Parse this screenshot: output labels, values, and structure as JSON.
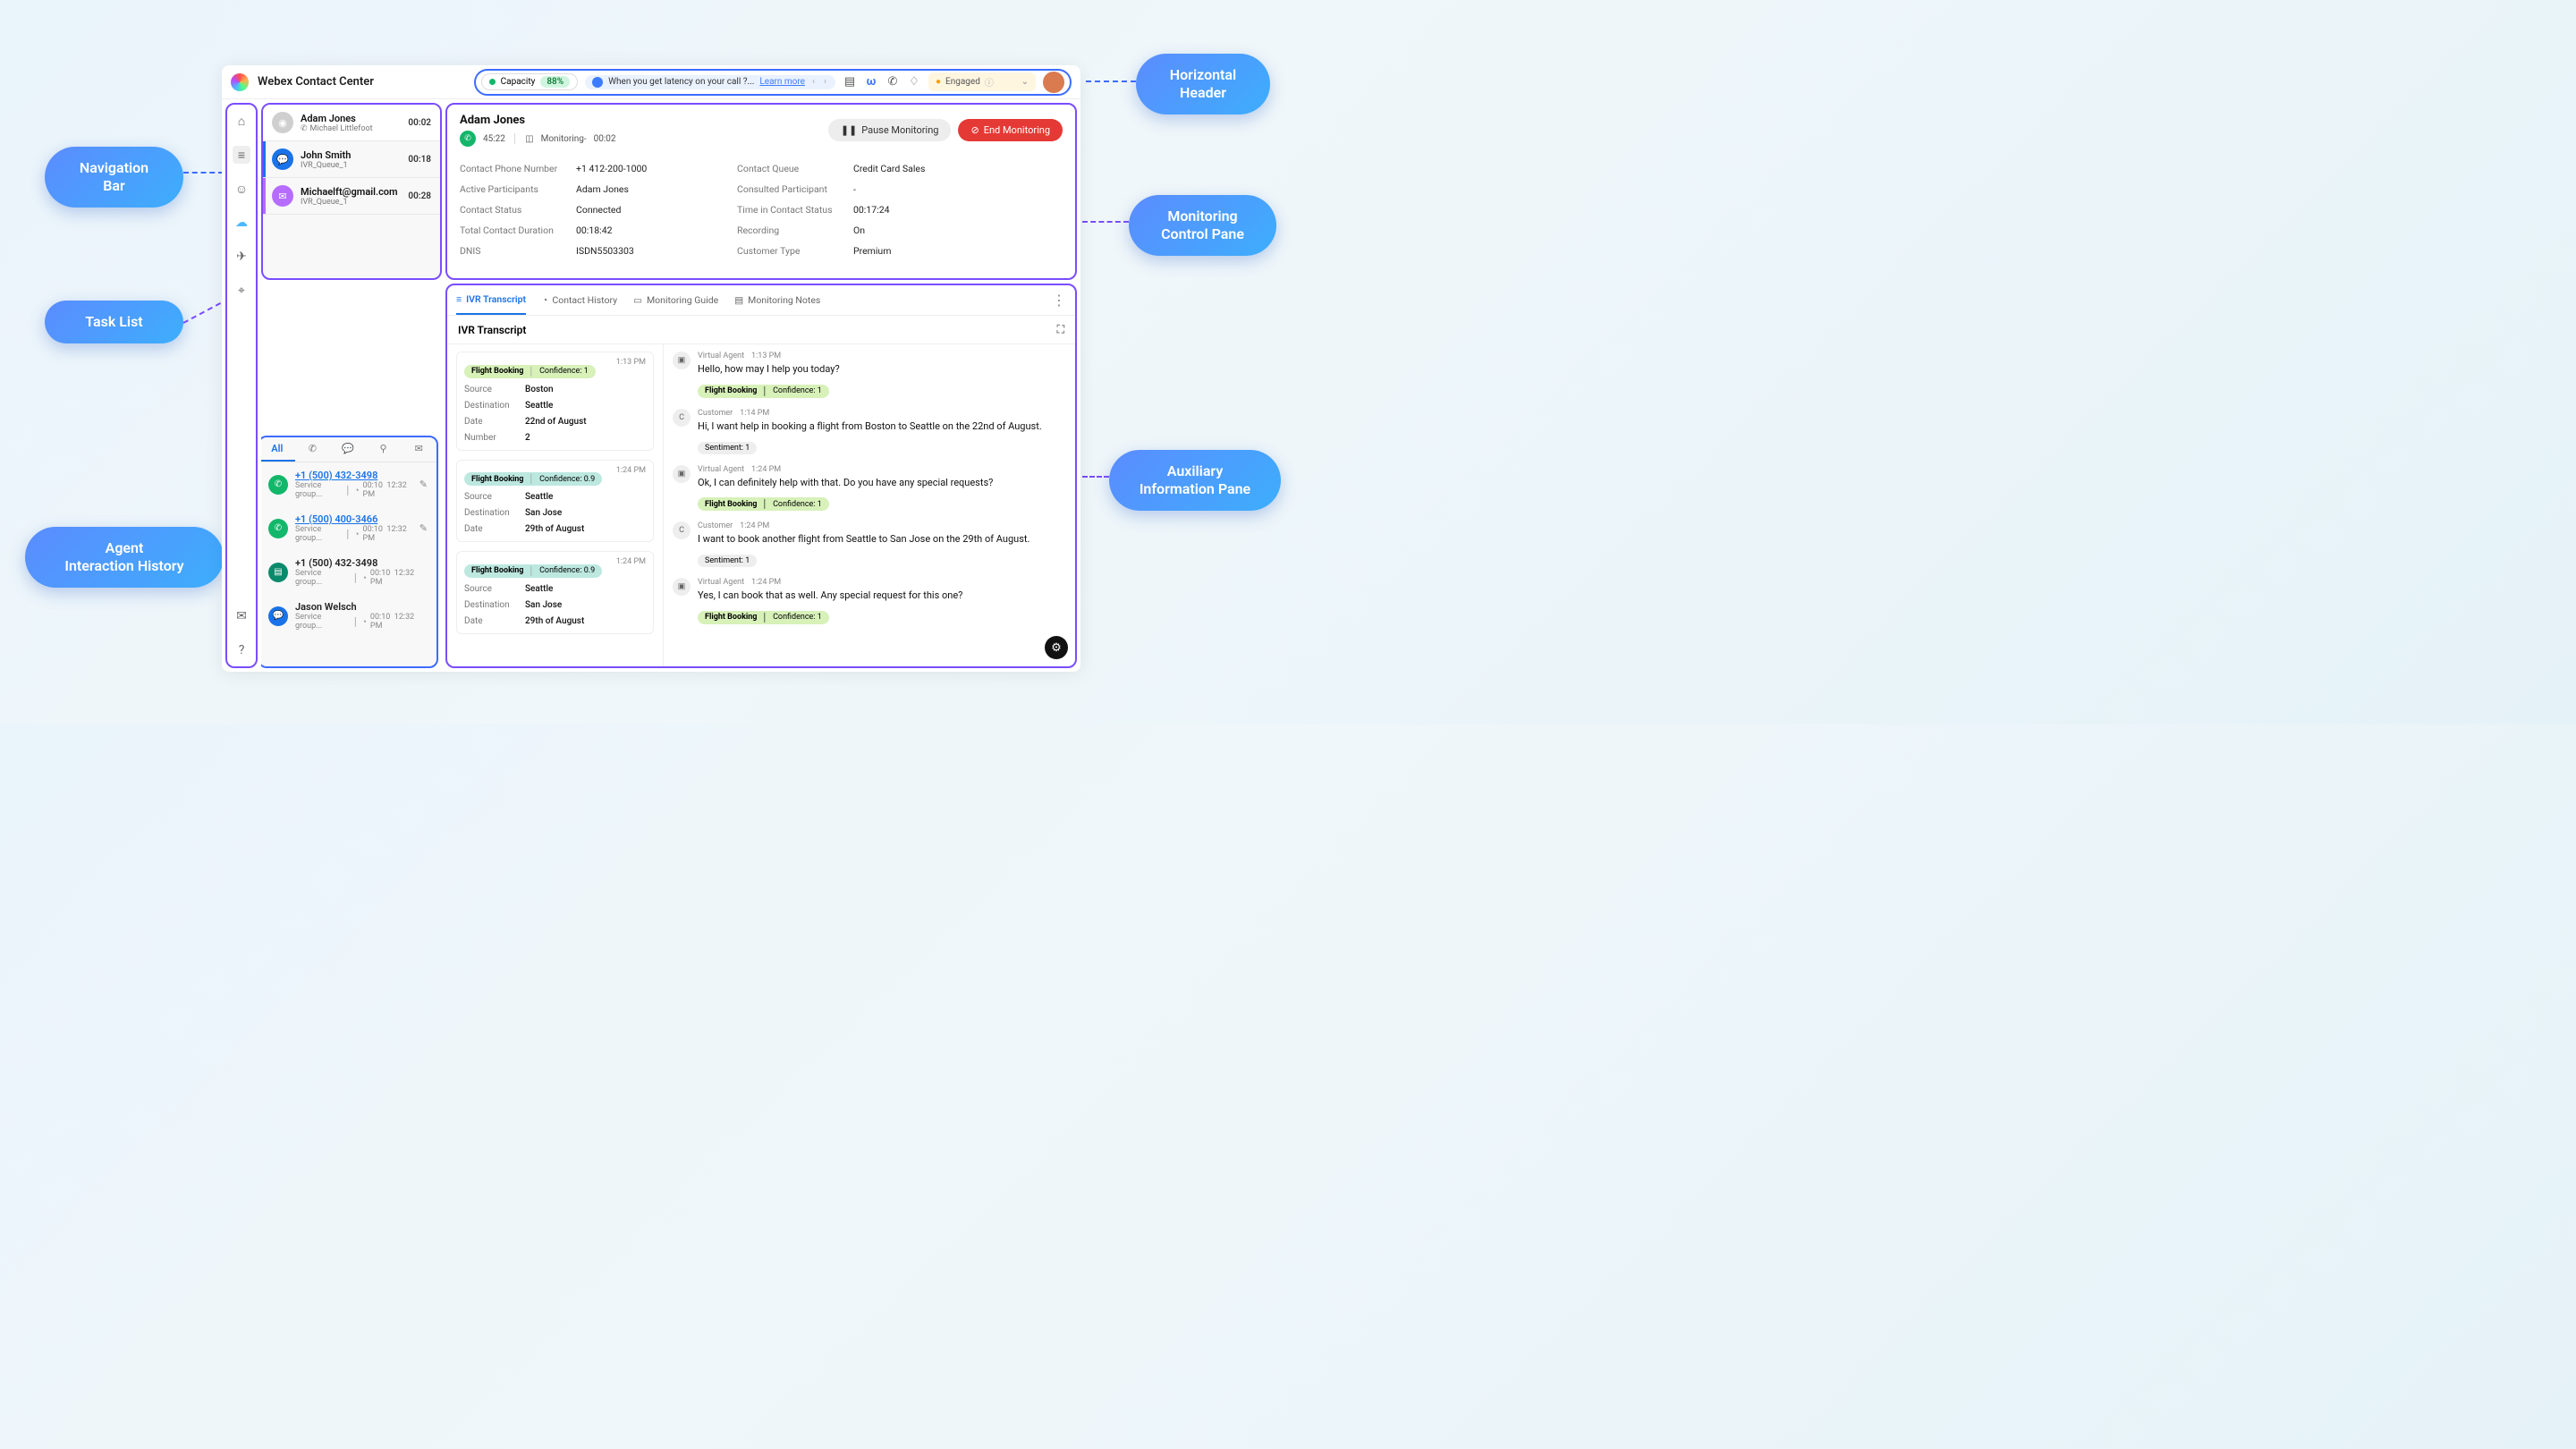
{
  "header": {
    "title": "Webex Contact Center",
    "capacity_label": "Capacity",
    "capacity_pct": "88%",
    "banner_text": "When you get latency on your call ?... ",
    "learn_more": "Learn more",
    "status": "Engaged"
  },
  "tasks": [
    {
      "name": "Adam Jones",
      "sub": "Michael Littlefoot",
      "time": "00:02",
      "color": "#cfcfcf",
      "icon": "user",
      "subicon": "phone"
    },
    {
      "name": "John Smith",
      "sub": "IVR_Queue_1",
      "time": "00:18",
      "color": "#1a73e8",
      "icon": "chat",
      "bar": "#1a73e8"
    },
    {
      "name": "Michaelft@gmail.com",
      "sub": "IVR_Queue_1",
      "time": "00:28",
      "color": "#b66dff",
      "icon": "mail",
      "bar": "#b66dff"
    }
  ],
  "monitor": {
    "name": "Adam Jones",
    "duration": "45:22",
    "mon_label": "Monitoring-",
    "mon_time": "00:02",
    "pause": "Pause Monitoring",
    "end": "End Monitoring",
    "fields": [
      [
        "Contact Phone Number",
        "+1 412-200-1000",
        "Contact Queue",
        "Credit Card Sales"
      ],
      [
        "Active Participants",
        "Adam Jones",
        "Consulted Participant",
        "-"
      ],
      [
        "Contact Status",
        "Connected",
        "Time in Contact Status",
        "00:17:24"
      ],
      [
        "Total Contact Duration",
        "00:18:42",
        "Recording",
        "On"
      ],
      [
        "DNIS",
        "ISDN5503303",
        "Customer Type",
        "Premium"
      ]
    ]
  },
  "history": {
    "tab_all": "All",
    "items": [
      {
        "name": "+1 (500) 432-3498",
        "sub": "Service group...",
        "dur": "00:10",
        "time": "12:32 PM",
        "color": "#12b76a",
        "link": true,
        "icon": "phone",
        "edit": true
      },
      {
        "name": "+1 (500) 400-3466",
        "sub": "Service group...",
        "dur": "00:10",
        "time": "12:32 PM",
        "color": "#12b76a",
        "link": true,
        "icon": "phone",
        "edit": true
      },
      {
        "name": "+1 (500) 432-3498",
        "sub": "Service group...",
        "dur": "00:10",
        "time": "12:32 PM",
        "color": "#0a8a6a",
        "link": false,
        "icon": "sms",
        "edit": false
      },
      {
        "name": "Jason Welsch",
        "sub": "Service group...",
        "dur": "00:10",
        "time": "12:32 PM",
        "color": "#1a73e8",
        "link": false,
        "icon": "chat",
        "edit": false
      }
    ]
  },
  "aux": {
    "tabs": [
      "IVR Transcript",
      "Contact History",
      "Monitoring Guide",
      "Monitoring Notes"
    ],
    "heading": "IVR Transcript",
    "cards": [
      {
        "tag": "Flight Booking",
        "conf": "Confidence: 1",
        "time": "1:13 PM",
        "tcls": "",
        "kv": [
          [
            "Source",
            "Boston"
          ],
          [
            "Destination",
            "Seattle"
          ],
          [
            "Date",
            "22nd of August"
          ],
          [
            "Number",
            "2"
          ]
        ]
      },
      {
        "tag": "Flight Booking",
        "conf": "Confidence: 0.9",
        "time": "1:24 PM",
        "tcls": "teal",
        "kv": [
          [
            "Source",
            "Seattle"
          ],
          [
            "Destination",
            "San Jose"
          ],
          [
            "Date",
            "29th of August"
          ]
        ]
      },
      {
        "tag": "Flight Booking",
        "conf": "Confidence: 0.9",
        "time": "1:24 PM",
        "tcls": "teal",
        "kv": [
          [
            "Source",
            "Seattle"
          ],
          [
            "Destination",
            "San Jose"
          ],
          [
            "Date",
            "29th of August"
          ]
        ]
      }
    ],
    "msgs": [
      {
        "who": "Virtual Agent",
        "time": "1:13 PM",
        "text": "Hello, how may I help you today?",
        "tag": "Flight Booking",
        "conf": "Confidence: 1",
        "ico": "bot"
      },
      {
        "who": "Customer",
        "time": "1:14 PM",
        "text": "Hi, I want help in booking a flight from Boston to Seattle on the 22nd of August.",
        "tag": "Sentiment: 1",
        "tcls": "gray",
        "ico": "C"
      },
      {
        "who": "Virtual Agent",
        "time": "1:24 PM",
        "text": "Ok, I can definitely help with that. Do you have any special requests?",
        "tag": "Flight Booking",
        "conf": "Confidence: 1",
        "ico": "bot"
      },
      {
        "who": "Customer",
        "time": "1:24 PM",
        "text": "I want to book another flight from Seattle to San Jose on the 29th of August.",
        "tag": "Sentiment: 1",
        "tcls": "gray",
        "ico": "C"
      },
      {
        "who": "Virtual Agent",
        "time": "1:24 PM",
        "text": "Yes, I can book that as well. Any special request for this one?",
        "tag": "Flight Booking",
        "conf": "Confidence: 1",
        "ico": "bot"
      }
    ]
  },
  "callouts": {
    "nav": "Navigation\nBar",
    "tasks": "Task List",
    "hist": "Agent\nInteraction History",
    "hdr": "Horizontal\nHeader",
    "mon": "Monitoring\nControl Pane",
    "aux": "Auxiliary\nInformation Pane"
  }
}
